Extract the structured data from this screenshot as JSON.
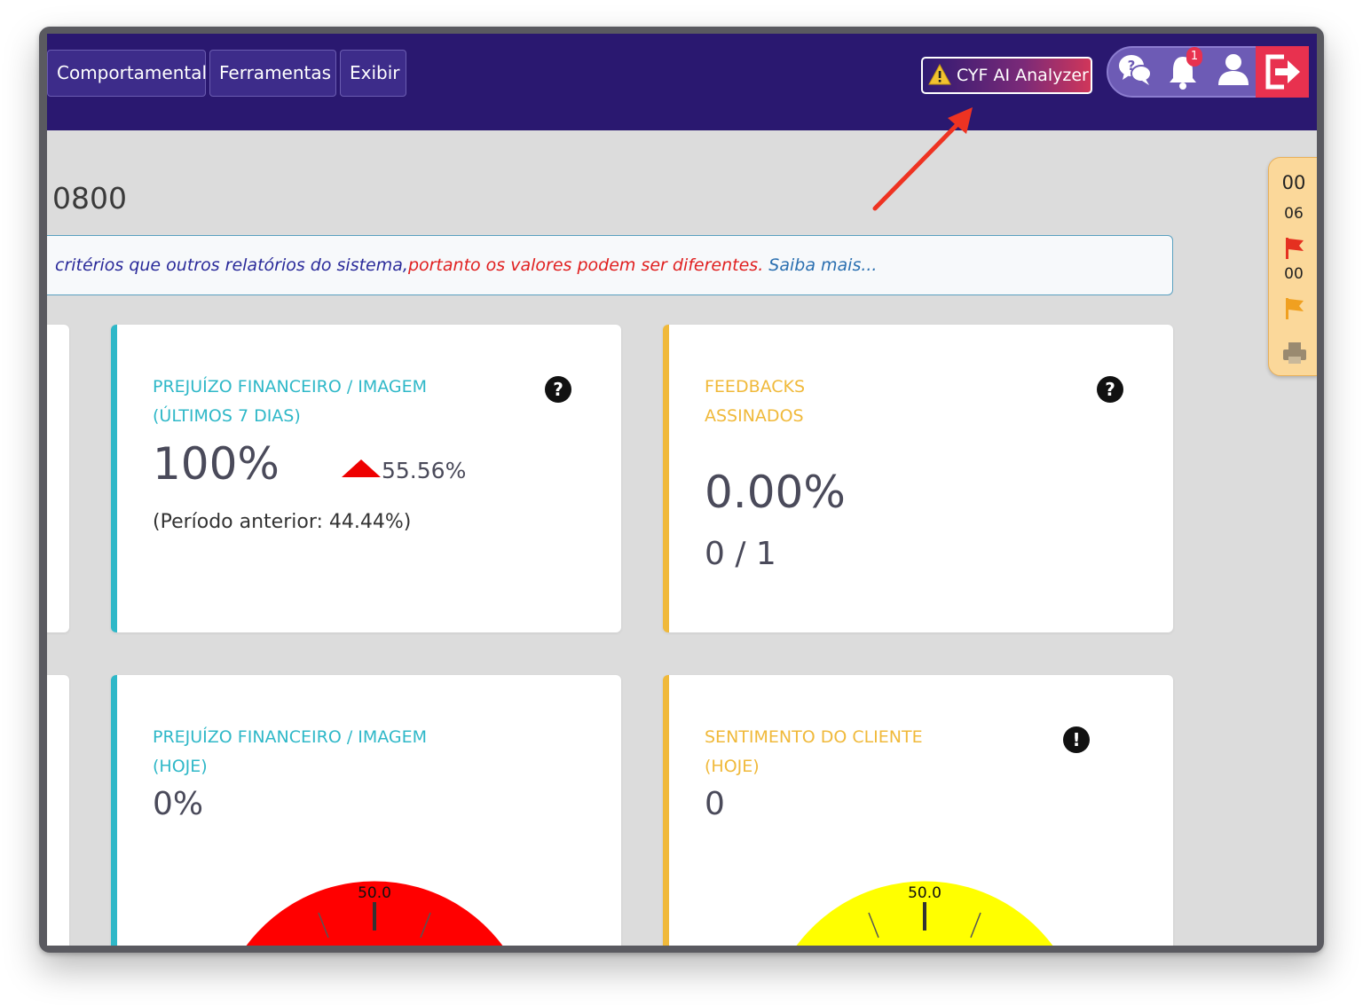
{
  "navbar": {
    "menu": [
      "Comportamental",
      "Ferramentas",
      "Exibir"
    ],
    "analyzer_label": "CYF AI Analyzer",
    "notification_count": "1"
  },
  "page": {
    "number_partial": "0800"
  },
  "notice": {
    "part_blue": "critérios que outros relatórios do sistema,",
    "part_red": "portanto os valores podem ser diferentes.",
    "link": "Saiba mais..."
  },
  "side_panel": {
    "count_top": "00",
    "count_mid": "06",
    "count_flag": "00"
  },
  "cards": {
    "loss_week": {
      "title_1": "PREJUÍZO FINANCEIRO / IMAGEM",
      "title_2": "(ÚLTIMOS 7 DIAS)",
      "value": "100%",
      "change": "55.56%",
      "previous": "(Período anterior: 44.44%)"
    },
    "feedbacks": {
      "title_1": "FEEDBACKS",
      "title_2": "ASSINADOS",
      "value": "0.00%",
      "ratio": "0 / 1"
    },
    "loss_today": {
      "title_1": "PREJUÍZO FINANCEIRO / IMAGEM",
      "title_2": "(HOJE)",
      "value": "0%",
      "gauge_label": "50.0",
      "gauge_color": "#ff0000"
    },
    "sentiment": {
      "title_1": "SENTIMENTO DO CLIENTE",
      "title_2": "(HOJE)",
      "value": "0",
      "gauge_label": "50.0",
      "gauge_color": "#ffff00"
    }
  },
  "colors": {
    "navbar": "#2a1870",
    "teal_accent": "#2fb8c8",
    "gold_accent": "#f0b93a",
    "alert_red": "#e8314f"
  }
}
